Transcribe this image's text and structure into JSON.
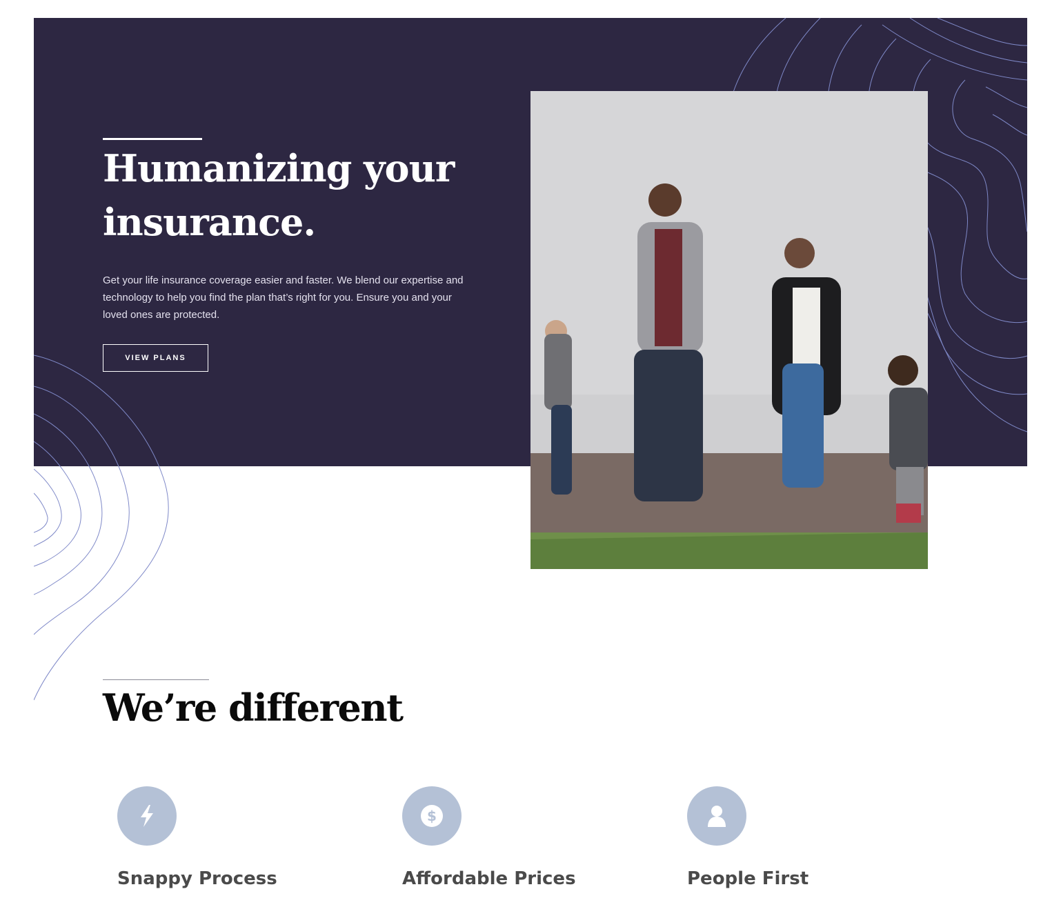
{
  "hero": {
    "title": "Humanizing your insurance.",
    "body": "Get your life insurance coverage easier and faster. We blend our expertise and technology to help you find the plan that’s right for you. Ensure you and your loved ones are protected.",
    "cta_label": "VIEW PLANS",
    "photo": "family-holding-hands-photo"
  },
  "features_section": {
    "title": "We’re different",
    "items": [
      {
        "icon": "lightning-bolt-icon",
        "title": "Snappy Process"
      },
      {
        "icon": "dollar-coin-icon",
        "title": "Affordable Prices"
      },
      {
        "icon": "person-icon",
        "title": "People First"
      }
    ]
  },
  "colors": {
    "hero_background": "#2d2742",
    "topo_lines": "#8b86c9",
    "feature_icon_circle": "#b4c1d6",
    "heading_dark": "#0a0a0a",
    "feature_title": "#4a4a4a"
  }
}
